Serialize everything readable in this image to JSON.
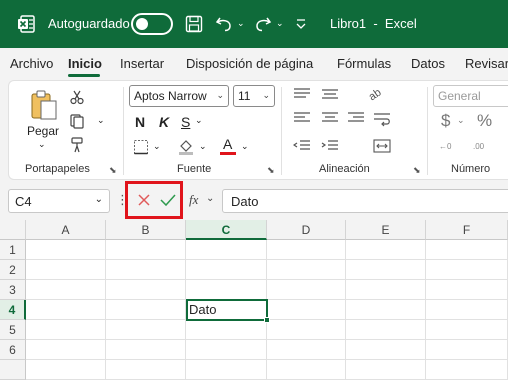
{
  "titlebar": {
    "autosave_label": "Autoguardado",
    "doc_title": "Libro1  -  Excel",
    "app_icon": "excel-icon",
    "save_icon": "save-icon",
    "undo_icon": "undo-icon",
    "redo_icon": "redo-icon",
    "customize_icon": "customize-qat-icon"
  },
  "menubar": {
    "tabs": [
      "Archivo",
      "Inicio",
      "Insertar",
      "Disposición de página",
      "Fórmulas",
      "Datos",
      "Revisar"
    ],
    "active_tab": "Inicio"
  },
  "ribbon": {
    "clipboard": {
      "label": "Portapapeles",
      "paste_label": "Pegar"
    },
    "font": {
      "label": "Fuente",
      "font_name": "Aptos Narrow",
      "font_size": "11",
      "bold": "N",
      "italic": "K",
      "underline": "S",
      "font_color_letter": "A",
      "font_color": "#e0141b"
    },
    "alignment": {
      "label": "Alineación"
    },
    "number": {
      "label": "Número",
      "format": "General",
      "currency_symbol": "$",
      "percent_symbol": "%"
    }
  },
  "formula_bar": {
    "name_box": "C4",
    "cancel_icon": "cancel-x-icon",
    "enter_icon": "enter-check-icon",
    "fx_label": "fx",
    "content": "Dato"
  },
  "sheet": {
    "columns": [
      "A",
      "B",
      "C",
      "D",
      "E",
      "F"
    ],
    "rows": [
      "1",
      "2",
      "3",
      "4",
      "5",
      "6"
    ],
    "selected_column": "C",
    "selected_row": "4",
    "active_cell_value": "Dato"
  },
  "colors": {
    "accent": "#0f6b3a",
    "highlight": "#e0141b",
    "cancel": "#e05a5a",
    "enter": "#2e9a4e"
  }
}
